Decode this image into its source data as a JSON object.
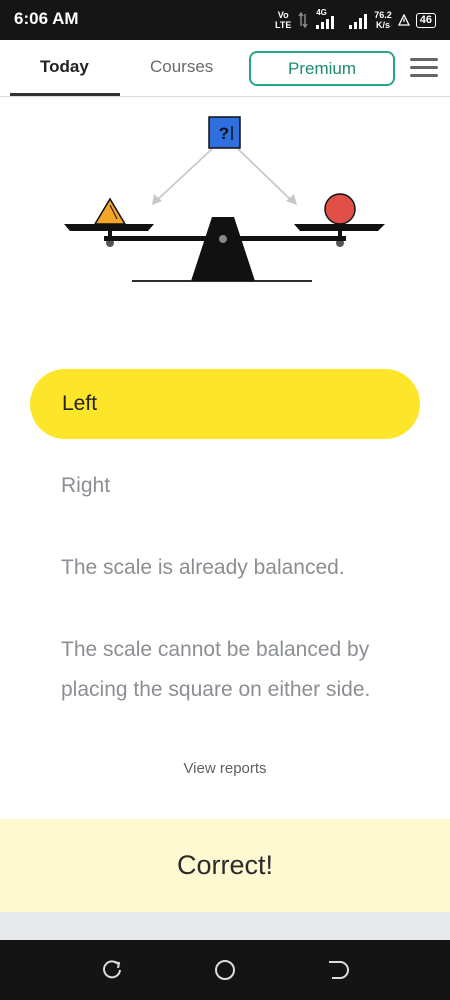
{
  "status_bar": {
    "time": "6:06 AM",
    "network_label": "Vo LTE",
    "signal_label": "4G",
    "speed_value": "76.2",
    "speed_unit": "K/s",
    "battery": "46"
  },
  "nav": {
    "tabs": [
      {
        "label": "Today",
        "active": true
      },
      {
        "label": "Courses",
        "active": false
      }
    ],
    "premium_label": "Premium"
  },
  "puzzle": {
    "question_mark": "?",
    "colors": {
      "square": "#2f6fe0",
      "triangle": "#f2a72a",
      "circle": "#e05048",
      "beam": "#111111",
      "arrow": "#c9c9c9"
    }
  },
  "options": [
    {
      "label": "Left",
      "selected": true
    },
    {
      "label": "Right",
      "selected": false
    },
    {
      "label": "The scale is already balanced.",
      "selected": false
    },
    {
      "label": "The scale cannot be balanced by placing the square on either side.",
      "selected": false
    }
  ],
  "view_reports_label": "View reports",
  "feedback": {
    "message": "Correct!",
    "background": "#fff9d1"
  }
}
